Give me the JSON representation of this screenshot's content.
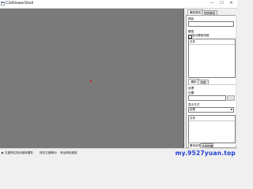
{
  "window": {
    "title": "C3dViewerShell",
    "controls": {
      "minimize": "—",
      "maximize": "☐",
      "close": "✕"
    }
  },
  "viewport": {
    "background": "#7a7a7a",
    "marker_color": "#d11e1e"
  },
  "statusbar": {
    "items": [
      "▶ 左键按住拖动旋转模型",
      "按住右键移动",
      "滚动滚轮缩放"
    ],
    "watermark": "my.9527yuan.top"
  },
  "panel": {
    "top_tabs": [
      "模型属性",
      "材质属性"
    ],
    "section_1": {
      "label_a": "颜色",
      "label_b": "模型",
      "checkbox_label": "显示模型线框",
      "list_header": "文件"
    },
    "mid_tabs": [
      "模型",
      "材质"
    ],
    "section_2": {
      "label_a": "纹理",
      "label_b": "位置",
      "label_c": "显示方式",
      "select_value": "纹理",
      "list_header": "文件"
    },
    "bottom_tabs": [
      "基本纹理",
      "法线贴图"
    ],
    "footer_checkbox": "显示图片文件"
  }
}
